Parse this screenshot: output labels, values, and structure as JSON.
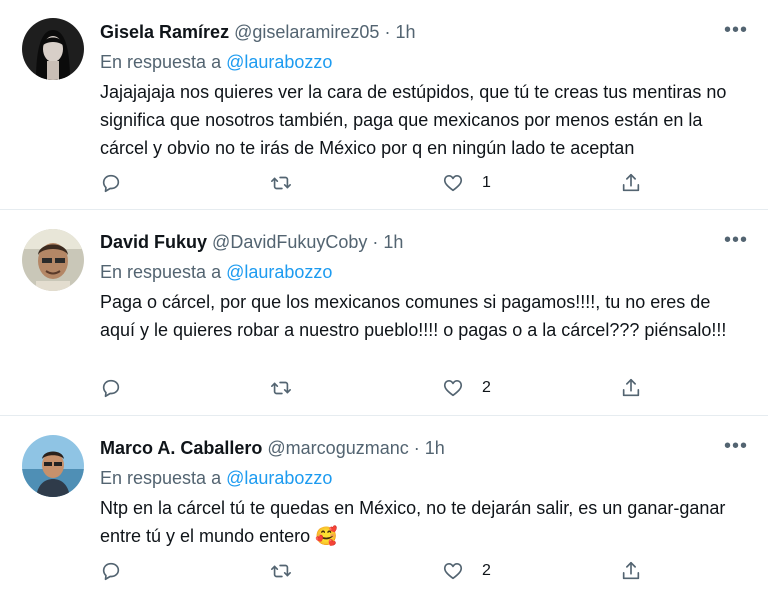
{
  "tweets": [
    {
      "name": "Gisela Ramírez",
      "handle": "@giselaramirez05",
      "time": "1h",
      "reply_prefix": "En respuesta a",
      "reply_to": "@laurabozzo",
      "text": "Jajajajaja nos quieres ver la cara de estúpidos, que tú te creas tus mentiras no significa que nosotros también, paga que mexicanos por menos están en la cárcel y obvio no te irás de México por q en ningún lado te aceptan",
      "likes": "1"
    },
    {
      "name": "David Fukuy",
      "handle": "@DavidFukuyCoby",
      "time": "1h",
      "reply_prefix": "En respuesta a",
      "reply_to": "@laurabozzo",
      "text": "Paga o cárcel, por que los mexicanos comunes si pagamos!!!!, tu no eres de aquí y le quieres robar a nuestro pueblo!!!! o pagas o a la cárcel??? piénsalo!!!",
      "likes": "2"
    },
    {
      "name": "Marco A. Caballero",
      "handle": "@marcoguzmanc",
      "time": "1h",
      "reply_prefix": "En respuesta a",
      "reply_to": "@laurabozzo",
      "text": "Ntp en la cárcel tú te quedas en México, no te dejarán salir, es un ganar-ganar entre tú y el mundo entero 🥰",
      "likes": "2"
    }
  ],
  "separator": "·",
  "more_glyph": "•••",
  "icons": [
    "reply-icon",
    "retweet-icon",
    "like-icon",
    "share-icon"
  ],
  "colors": {
    "link": "#1d9bf0",
    "muted": "#536471",
    "text": "#0f1419",
    "divider": "#e6ecf0"
  }
}
